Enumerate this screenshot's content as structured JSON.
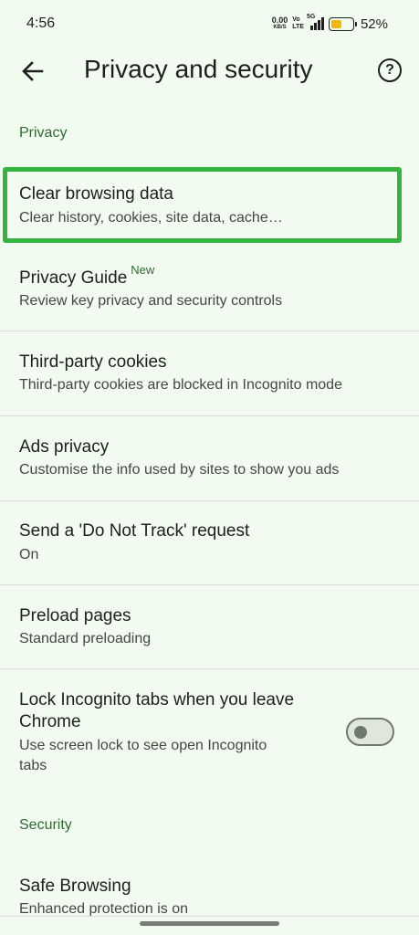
{
  "status_bar": {
    "time": "4:56",
    "net_speed": "0.00",
    "net_unit": "KB/S",
    "volte_top": "Vo",
    "volte_bottom": "LTE",
    "network": "5G",
    "battery_percent": "52%",
    "battery_level": 0.52,
    "battery_color": "#f5b60a"
  },
  "app_bar": {
    "title": "Privacy and security",
    "back_icon": "arrow-left-icon",
    "help_icon": "help-circle-icon",
    "help_glyph": "?"
  },
  "sections": {
    "privacy_header": "Privacy",
    "security_header": "Security"
  },
  "items": {
    "clear_browsing": {
      "title": "Clear browsing data",
      "subtitle": "Clear history, cookies, site data, cache…"
    },
    "privacy_guide": {
      "title": "Privacy Guide",
      "badge": "New",
      "subtitle": "Review key privacy and security controls"
    },
    "third_party": {
      "title": "Third-party cookies",
      "subtitle": "Third-party cookies are blocked in Incognito mode"
    },
    "ads_privacy": {
      "title": "Ads privacy",
      "subtitle": "Customise the info used by sites to show you ads"
    },
    "do_not_track": {
      "title": "Send a 'Do Not Track' request",
      "subtitle": "On"
    },
    "preload": {
      "title": "Preload pages",
      "subtitle": "Standard preloading"
    },
    "lock_incognito": {
      "title_line1": "Lock Incognito tabs when you leave",
      "title_line2": "Chrome",
      "subtitle_line1": "Use screen lock to see open Incognito",
      "subtitle_line2": "tabs",
      "toggle_on": false
    },
    "safe_browsing": {
      "title": "Safe Browsing",
      "subtitle": "Enhanced protection is on"
    }
  },
  "colors": {
    "background": "#f2fbf0",
    "accent": "#2e6b33",
    "highlight": "#35b53f"
  }
}
